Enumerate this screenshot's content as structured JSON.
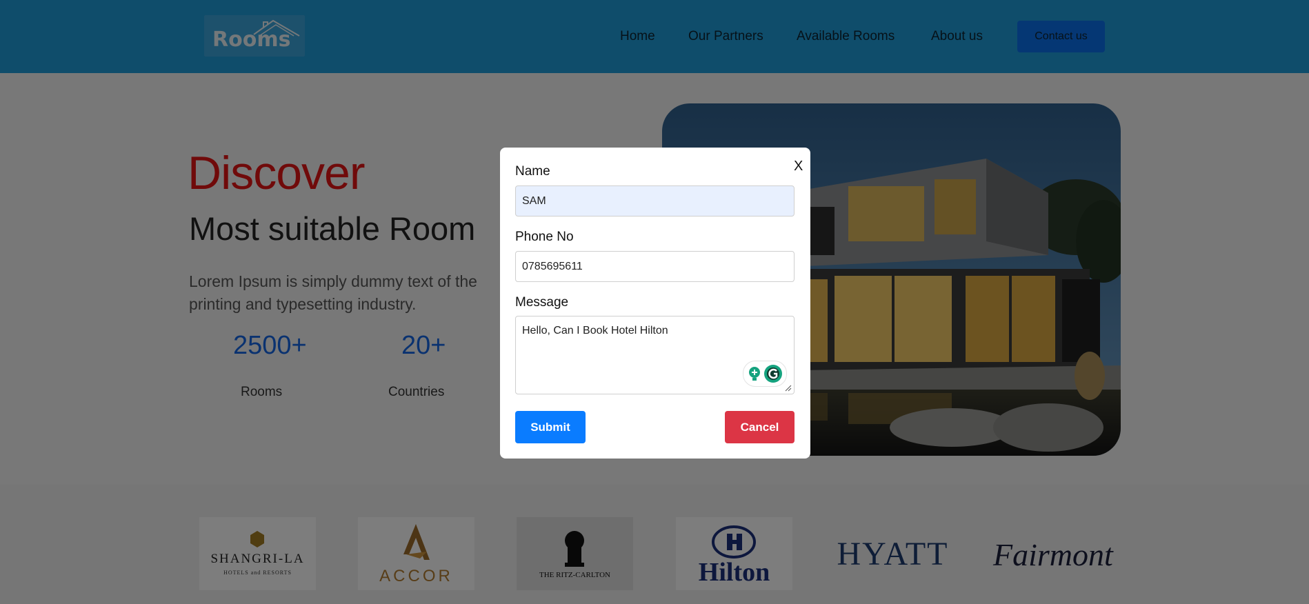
{
  "header": {
    "logo_text": "Rooms",
    "nav": [
      {
        "label": "Home"
      },
      {
        "label": "Our Partners"
      },
      {
        "label": "Available Rooms"
      },
      {
        "label": "About us"
      }
    ],
    "contact_label": "Contact us"
  },
  "hero": {
    "title": "Discover",
    "subtitle": "Most suitable Room",
    "description": "Lorem Ipsum is simply dummy text of the printing and typesetting industry.",
    "stats": [
      {
        "value": "2500+",
        "label": "Rooms"
      },
      {
        "value": "20+",
        "label": "Countries"
      }
    ]
  },
  "partners": [
    {
      "name": "SHANGRI-LA",
      "tagline": "HOTELS and RESORTS"
    },
    {
      "name": "ACCOR"
    },
    {
      "name": "THE RITZ-CARLTON"
    },
    {
      "name": "Hilton"
    },
    {
      "name": "HYATT"
    },
    {
      "name": "Fairmont"
    }
  ],
  "modal": {
    "close_label": "X",
    "name_label": "Name",
    "name_value": "SAM",
    "phone_label": "Phone No",
    "phone_value": "0785695611",
    "message_label": "Message",
    "message_value": "Hello, Can I Book Hotel Hilton",
    "submit_label": "Submit",
    "cancel_label": "Cancel"
  },
  "colors": {
    "header_bg": "#1f9bd6",
    "accent_red": "#e01414",
    "stat_blue": "#1565e0",
    "submit_blue": "#0a7cff",
    "cancel_red": "#dc3545"
  }
}
